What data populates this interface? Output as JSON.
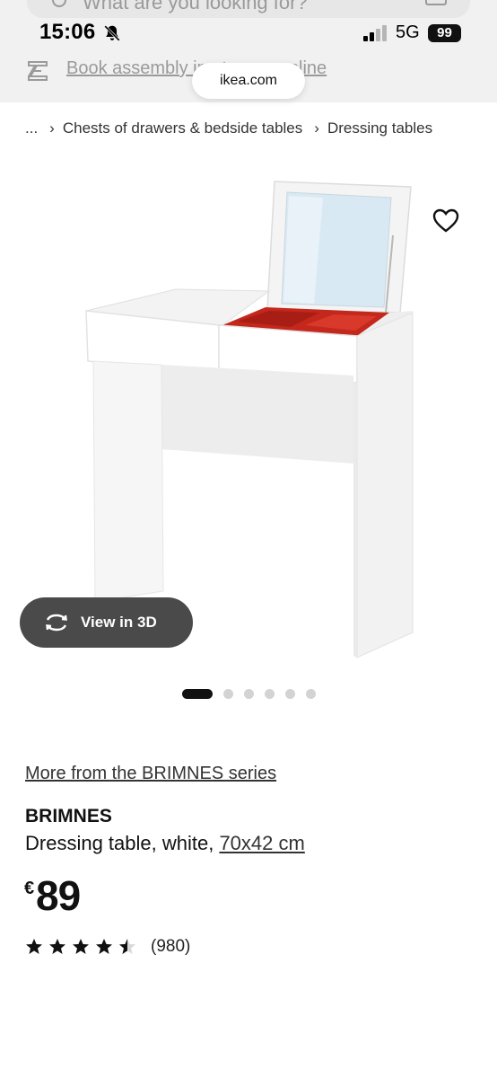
{
  "search": {
    "placeholder": "What are you looking for?"
  },
  "status_bar": {
    "time": "15:06",
    "network": "5G",
    "battery": "99"
  },
  "assembly": {
    "link_text": "Book assembly in-store or online"
  },
  "browser": {
    "domain": "ikea.com"
  },
  "breadcrumb": {
    "ellipsis": "...",
    "items": [
      "Chests of drawers & bedside tables",
      "Dressing tables"
    ]
  },
  "gallery": {
    "view_3d_label": "View in 3D",
    "dot_count": 6,
    "active_dot": 0
  },
  "product": {
    "series_link": "More from the BRIMNES series",
    "name": "BRIMNES",
    "description": "Dressing table, white, ",
    "size": "70x42 cm",
    "currency": "€",
    "price": "89",
    "rating": 4.5,
    "review_count": "(980)"
  },
  "colors": {
    "accent_dark": "#111111",
    "button_bg": "#4a4a4a",
    "drawer_red": "#c4271c"
  }
}
